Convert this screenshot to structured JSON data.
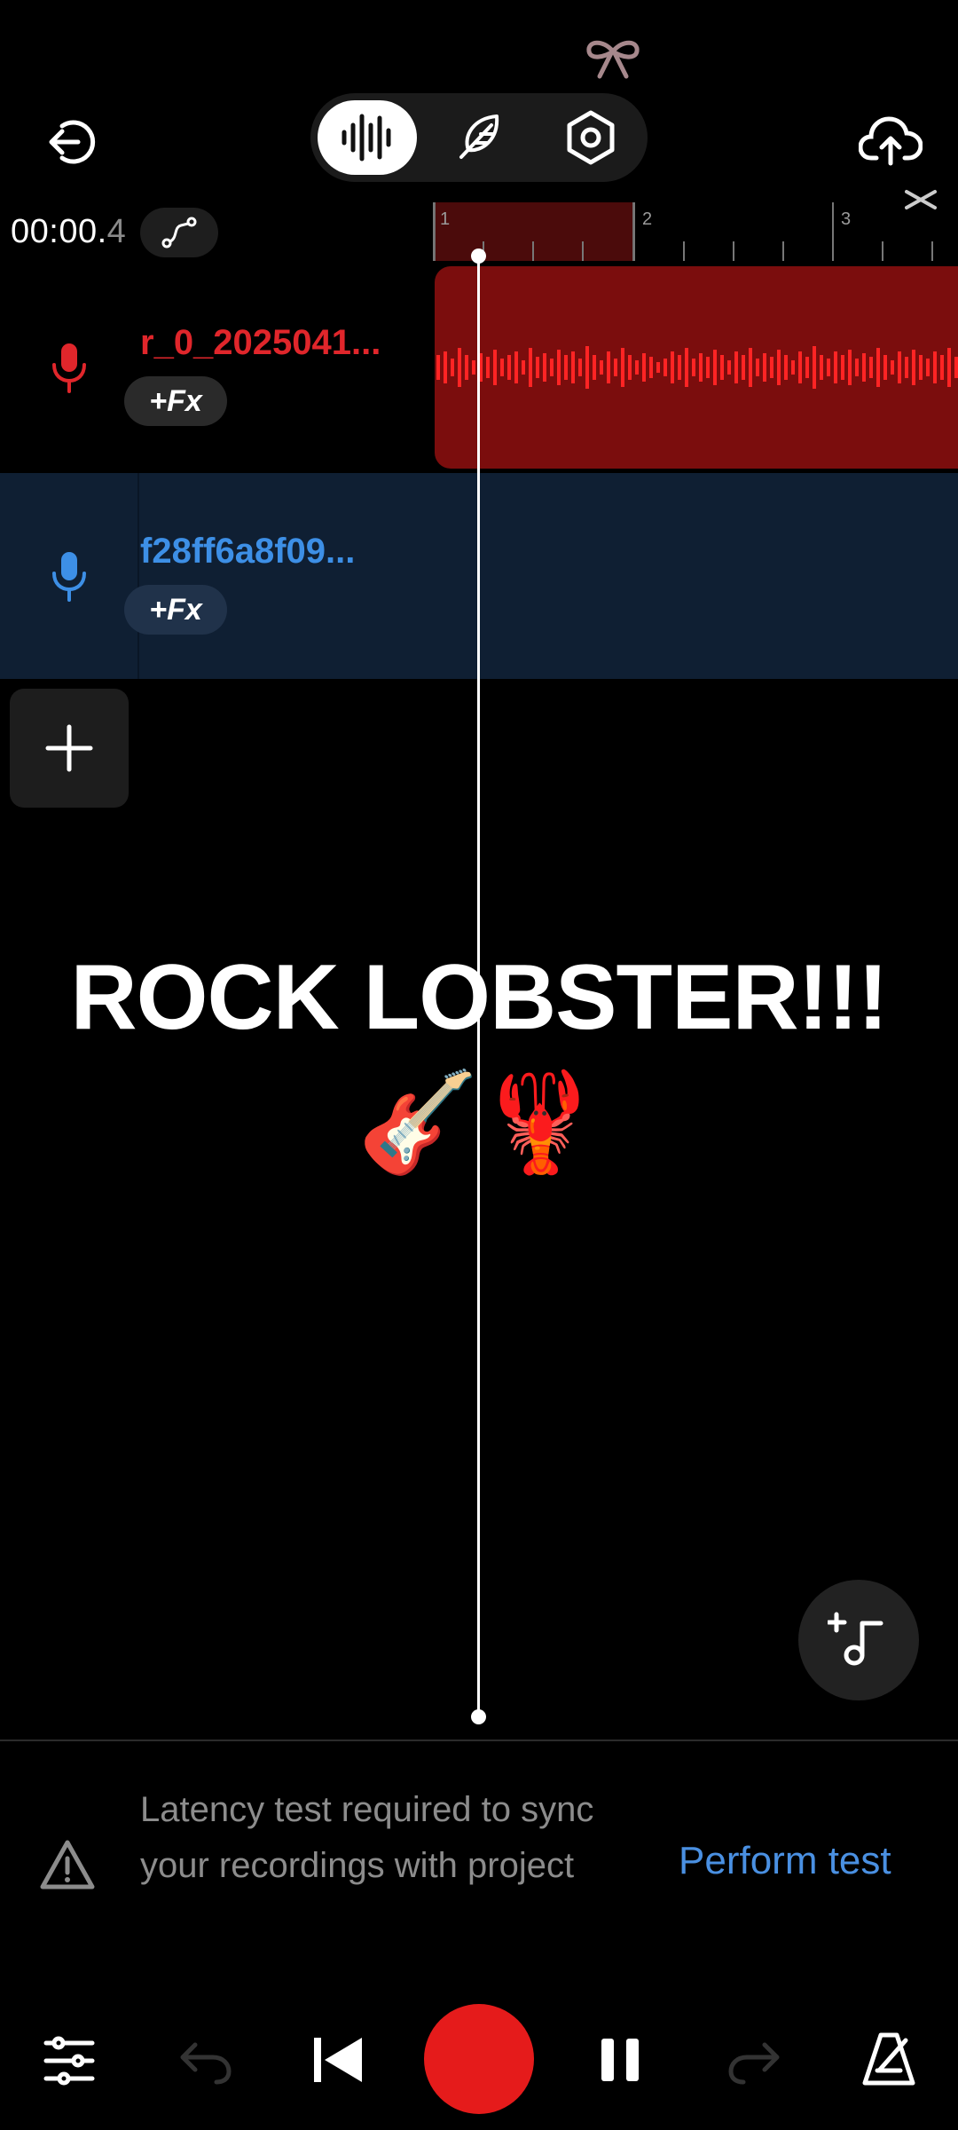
{
  "header": {
    "back_icon": "exit-icon",
    "cloud_icon": "cloud-upload-icon",
    "modes": [
      {
        "icon": "waveform-icon",
        "active": true
      },
      {
        "icon": "feather-icon",
        "active": false
      },
      {
        "icon": "settings-hex-icon",
        "active": false
      }
    ],
    "ribbon_icon": "bow-icon"
  },
  "time": {
    "main": "00:00.",
    "fraction": "4"
  },
  "ruler": {
    "bars": [
      "1",
      "2",
      "3"
    ]
  },
  "tracks": [
    {
      "name": "r_0_2025041...",
      "fx_label": "+Fx",
      "color": "#e0262b"
    },
    {
      "name": "f28ff6a8f09...",
      "fx_label": "+Fx",
      "color": "#3d8fe6"
    }
  ],
  "headline": "ROCK LOBSTER!!!",
  "emojis": "🎸🦞",
  "latency": {
    "message": "Latency test required to sync your recordings with project",
    "action": "Perform test"
  },
  "colors": {
    "accent_red": "#e51b1b",
    "accent_blue": "#4a90e2"
  }
}
